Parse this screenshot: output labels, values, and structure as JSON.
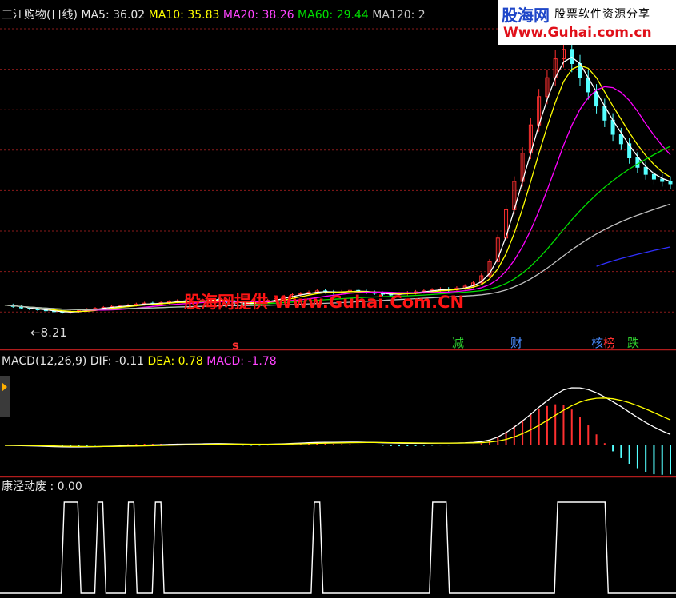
{
  "colors": {
    "background": "#000000",
    "grid": "#8a1a1a",
    "separator": "#b01c1c",
    "up": "#ff3030",
    "down": "#54ffff",
    "ma5": "#ffffff",
    "ma10": "#ffff00",
    "ma20": "#ff00ff",
    "ma60": "#00dd00",
    "ma120": "#c0c0c0",
    "ma250": "#3030ff",
    "macd_label": "#ff40ff",
    "signal_line": "#ffffff"
  },
  "main_panel": {
    "title": "三江购物(日线)",
    "ma5_label": "MA5:",
    "ma5_value": "36.02",
    "ma10_label": "MA10:",
    "ma10_value": "35.83",
    "ma20_label": "MA20:",
    "ma20_value": "38.26",
    "ma60_label": "MA60:",
    "ma60_value": "29.44",
    "ma120_label": "MA120:",
    "ma120_value": "2",
    "low_marker": "←8.21",
    "watermark": "股海网提供 Www.Guhai.Com.CN",
    "signal_mark": "s",
    "event_tags": [
      {
        "text": "减",
        "color": "#2ecc2e"
      },
      {
        "text": "财",
        "color": "#3a86ff"
      },
      {
        "text": "核",
        "color": "#3a86ff"
      },
      {
        "text": "榜",
        "color": "#ff3030"
      },
      {
        "text": "跌",
        "color": "#2ecc2e"
      }
    ]
  },
  "banner": {
    "logo": "股海网",
    "slogan": "股票软件资源分享",
    "url": "Www.Guhai.com.cn"
  },
  "macd_panel": {
    "label": "MACD(12,26,9)",
    "dif_label": "DIF:",
    "dif_value": "-0.11",
    "dea_label": "DEA:",
    "dea_value": "0.78",
    "macd_label": "MACD:",
    "macd_value": "-1.78"
  },
  "indicator_panel": {
    "label": "康泾动废",
    "value": ": 0.00"
  },
  "chart_data": [
    {
      "type": "candlestick",
      "title": "三江购物(日线)",
      "low_marker": 8.21,
      "series": [
        {
          "name": "MA5",
          "last": 36.02
        },
        {
          "name": "MA10",
          "last": 35.83
        },
        {
          "name": "MA20",
          "last": 38.26
        },
        {
          "name": "MA60",
          "last": 29.44
        }
      ],
      "close_path": [
        9.8,
        9.5,
        9.2,
        9.0,
        8.8,
        8.6,
        8.4,
        8.21,
        8.4,
        8.6,
        8.9,
        9.1,
        9.3,
        9.5,
        9.6,
        9.8,
        10.0,
        10.2,
        10.0,
        10.3,
        10.5,
        10.7,
        10.4,
        10.6,
        10.8,
        11.0,
        10.8,
        10.5,
        10.2,
        10.0,
        10.2,
        10.5,
        10.8,
        11.2,
        11.6,
        12.0,
        12.2,
        12.5,
        12.8,
        12.6,
        12.4,
        12.6,
        12.9,
        12.7,
        12.5,
        12.3,
        12.1,
        12.0,
        12.2,
        12.4,
        12.6,
        12.8,
        13.0,
        13.2,
        13.0,
        13.4,
        13.8,
        14.5,
        16.0,
        19.0,
        24.0,
        30.0,
        36.0,
        42.0,
        48.0,
        54.0,
        58.0,
        62.0,
        64.0,
        61.0,
        58.0,
        55.0,
        52.0,
        49.0,
        46.0,
        44.0,
        41.0,
        39.0,
        37.5,
        36.5,
        36.0,
        35.5
      ]
    },
    {
      "type": "bar",
      "title": "MACD(12,26,9)",
      "series": [
        {
          "name": "DIF",
          "last": -0.11
        },
        {
          "name": "DEA",
          "last": 0.78
        },
        {
          "name": "MACD",
          "last": -1.78
        }
      ]
    },
    {
      "type": "line",
      "title": "康泾动废",
      "series": [
        {
          "name": "康泾动废",
          "last": 0.0
        }
      ],
      "high_intervals_pct": [
        [
          9.5,
          11.5
        ],
        [
          14.5,
          15.2
        ],
        [
          19.0,
          19.8
        ],
        [
          23.0,
          23.8
        ],
        [
          46.5,
          47.3
        ],
        [
          64.0,
          66.0
        ],
        [
          82.5,
          89.5
        ]
      ]
    }
  ]
}
